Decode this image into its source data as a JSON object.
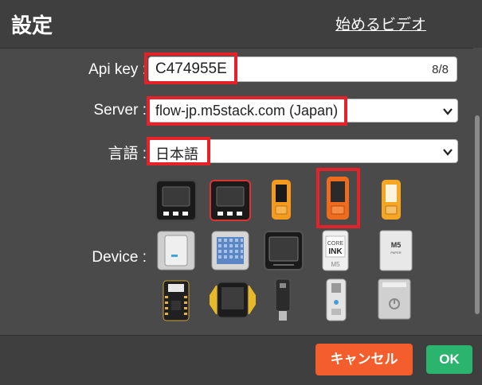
{
  "header": {
    "title": "設定",
    "video_link": "始めるビデオ"
  },
  "form": {
    "apikey": {
      "label": "Api key :",
      "value": "C474955E",
      "counter": "8/8"
    },
    "server": {
      "label": "Server :",
      "value": "flow-jp.m5stack.com (Japan)"
    },
    "language": {
      "label": "言語 :",
      "value": "日本語"
    },
    "device": {
      "label": "Device :"
    }
  },
  "devices": [
    "m5stack-basic-black",
    "m5stack-gray-red",
    "m5stickc-orange",
    "m5stickc-plus-orange-selected",
    "m5stickc-plus-light",
    "m5-atom-module",
    "m5-atom-matrix",
    "m5-core2",
    "m5-coreink",
    "m5-paper",
    "m5-stamp-pico",
    "m5-tough",
    "m5-atom-u",
    "m5-atom-echo",
    "m5-station"
  ],
  "footer": {
    "cancel": "キャンセル",
    "ok": "OK"
  },
  "colors": {
    "highlight": "#e3222a",
    "cancel": "#f45d2c",
    "ok": "#2bb46d"
  }
}
